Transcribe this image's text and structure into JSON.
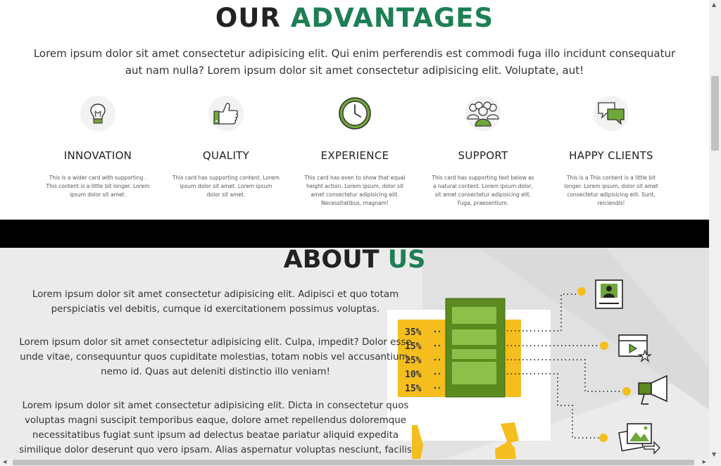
{
  "advantages": {
    "title_part1": "OUR",
    "title_part2": "ADVANTAGES",
    "lead": "Lorem ipsum dolor sit amet consectetur adipisicing elit. Qui enim perferendis est commodi fuga illo incidunt consequatur aut nam nulla? Lorem ipsum dolor sit amet consectetur adipisicing elit. Voluptate, aut!",
    "cards": [
      {
        "icon": "lightbulb-icon",
        "title": "INNOVATION",
        "text": "This is a wider card with supporting . This content is a little bit longer. Lorem ipsum dolor sit amet."
      },
      {
        "icon": "thumbs-up-icon",
        "title": "QUALITY",
        "text": "This card has supporting content. Lorem ipsum dolor sit amet. Lorem ipsum dolor sit amet."
      },
      {
        "icon": "clock-icon",
        "title": "EXPERIENCE",
        "text": "This card has even to show that equal height action. Lorem ipsum, dolor sit amet consectetur adipisicing elit. Necessitatibus, magnam!"
      },
      {
        "icon": "team-icon",
        "title": "SUPPORT",
        "text": "This card has supporting text below as a natural content. Lorem ipsum dolor, sit amet consectetur adipisicing elit. Fuga, praesentium."
      },
      {
        "icon": "chat-bubbles-icon",
        "title": "HAPPY CLIENTS",
        "text": "This is a This content is a little bit longer. Lorem ipsum, dolor sit amet consectetur adipisicing elit. Sunt, reiciendis!"
      }
    ]
  },
  "about": {
    "title_part1": "ABOUT",
    "title_part2": "US",
    "paragraphs": [
      "Lorem ipsum dolor sit amet consectetur adipisicing elit. Adipisci et quo totam perspiciatis vel debitis, cumque id exercitationem possimus voluptas.",
      "Lorem ipsum dolor sit amet consectetur adipisicing elit. Culpa, impedit? Dolor esse unde vitae, consequuntur quos cupiditate molestias, totam nobis vel accusantium, nemo id. Quas aut deleniti distinctio illo veniam!",
      "Lorem ipsum dolor sit amet consectetur adipisicing elit. Dicta in consectetur quos voluptas magni suscipit temporibus eaque, dolore amet repellendus doloremque necessitatibus fugiat sunt ipsum ad delectus beatae pariatur aliquid expedita similique dolor deserunt quo vero ipsam. Alias aspernatur voluptas nesciunt, facilis eaque error. Inventore nostrum"
    ],
    "illustration_percents": [
      "35%",
      "15%",
      "25%",
      "10%",
      "15%"
    ]
  },
  "colors": {
    "accent_green": "#1e7f55",
    "icon_green": "#6fa83a",
    "illustration_yellow": "#f5be1e"
  }
}
